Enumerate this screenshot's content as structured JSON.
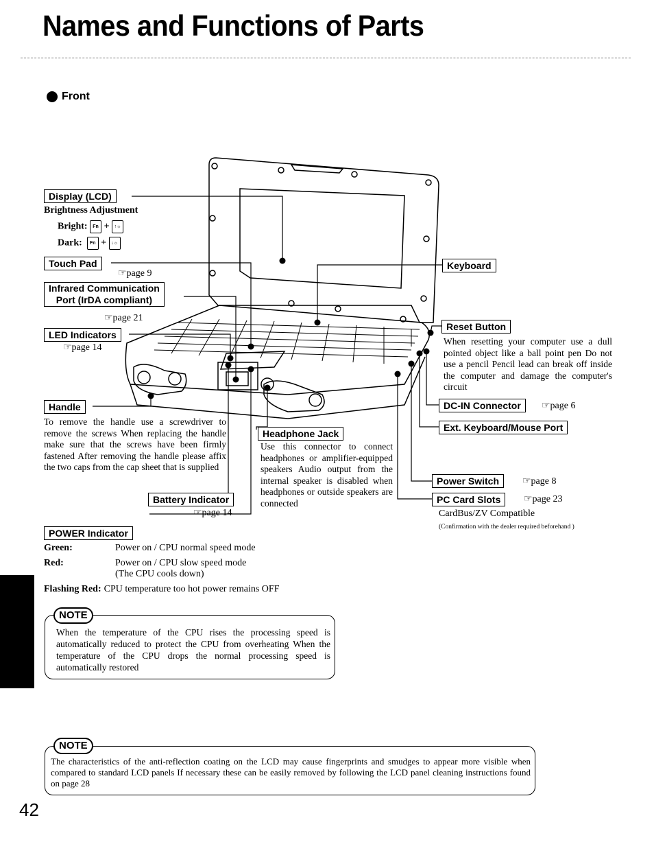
{
  "page": {
    "title": "Names and Functions of Parts",
    "section": "Front",
    "page_number": "42"
  },
  "labels": {
    "display": {
      "label": "Display (LCD)"
    },
    "brightness": {
      "heading": "Brightness Adjustment",
      "bright_label": "Bright:",
      "dark_label": "Dark:",
      "plus": "+",
      "fn_key": "Fn",
      "bright_key": "↑☼",
      "dark_key": "↓☼"
    },
    "touchpad": {
      "label": "Touch Pad",
      "page_ref": "☞page 9"
    },
    "infrared": {
      "label_line1": "Infrared Communication",
      "label_line2": "Port (IrDA compliant)",
      "page_ref": "☞page 21"
    },
    "led": {
      "label": "LED Indicators",
      "page_ref": "☞page 14"
    },
    "handle": {
      "label": "Handle",
      "description": "To remove the handle use a screwdriver to remove the screws When replacing the handle make sure that the screws have been firmly fastened After removing the handle please affix the two caps from the cap sheet that is supplied"
    },
    "battery": {
      "label": "Battery Indicator",
      "page_ref": "☞page 14"
    },
    "headphone": {
      "label": "Headphone Jack",
      "description": "Use this connector to connect headphones or amplifier-equipped speakers Audio output from the internal speaker is disabled when headphones or outside speakers are connected"
    },
    "keyboard": {
      "label": "Keyboard"
    },
    "reset": {
      "label": "Reset Button",
      "description": "When resetting your computer use a dull pointed object like a ball point pen Do not use a pencil Pencil lead can break off inside the computer and damage the computer's circuit"
    },
    "dcin": {
      "label": "DC-IN Connector",
      "page_ref": "☞page 6"
    },
    "extport": {
      "label": "Ext. Keyboard/Mouse Port"
    },
    "powerswitch": {
      "label": "Power Switch",
      "page_ref": "☞page 8"
    },
    "pccard": {
      "label": "PC Card Slots",
      "page_ref": "☞page 23",
      "compat": "CardBus/ZV Compatible",
      "note": "(Confirmation with the dealer required beforehand )"
    },
    "power_indicator": {
      "label": "POWER Indicator",
      "rows": [
        {
          "state": "Green:",
          "meaning": "Power on / CPU normal speed mode"
        },
        {
          "state": "Red:",
          "meaning": "Power on / CPU slow speed mode",
          "meaning2": "(The CPU cools down)"
        },
        {
          "state": "Flashing Red:",
          "meaning": "CPU temperature too hot power remains OFF"
        }
      ]
    }
  },
  "notes": [
    {
      "tag": "NOTE",
      "text": "When the temperature of the CPU rises the processing speed is automatically reduced to protect the CPU from overheating When the temperature of the CPU drops the normal processing speed is automatically restored"
    },
    {
      "tag": "NOTE",
      "text": "The characteristics of the anti-reflection coating on the LCD may cause fingerprints and smudges to appear more visible when compared to standard LCD panels If necessary these can be easily removed by following the LCD panel cleaning instructions found on page 28"
    }
  ]
}
